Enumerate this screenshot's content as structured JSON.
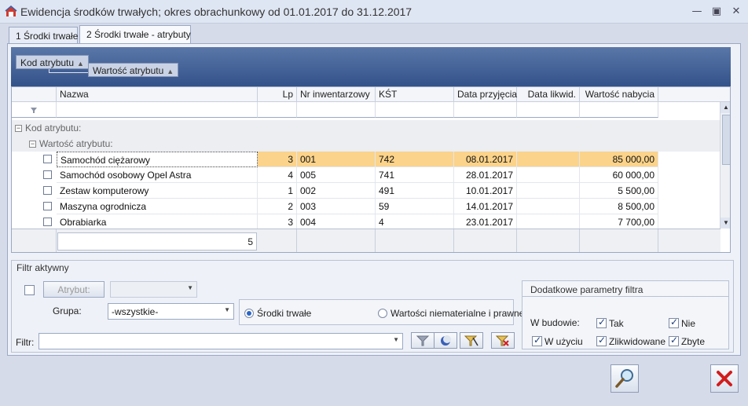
{
  "window": {
    "title": "Ewidencja środków trwałych; okres obrachunkowy od 01.01.2017 do 31.12.2017",
    "minimize": "—",
    "restore": "▣",
    "close": "✕"
  },
  "tabs": [
    {
      "label": "1 Środki trwałe"
    },
    {
      "label": "2 Środki trwałe - atrybuty"
    }
  ],
  "grouping": {
    "chip1": "Kod atrybutu",
    "chip2": "Wartość atrybutu"
  },
  "columns": {
    "name": "Nazwa",
    "lp": "Lp",
    "inv": "Nr inwentarzowy",
    "kst": "KŚT",
    "date_acq": "Data przyjęcia",
    "date_liq": "Data likwid.",
    "value": "Wartość nabycia"
  },
  "groups": {
    "g1": "Kod atrybutu:",
    "g2": "Wartość atrybutu:"
  },
  "rows": [
    {
      "name": "Samochód ciężarowy",
      "lp": "3",
      "inv": "001",
      "kst": "742",
      "date_acq": "08.01.2017",
      "date_liq": "",
      "value": "85 000,00"
    },
    {
      "name": "Samochód osobowy Opel Astra",
      "lp": "4",
      "inv": "005",
      "kst": "741",
      "date_acq": "28.01.2017",
      "date_liq": "",
      "value": "60 000,00"
    },
    {
      "name": "Zestaw komputerowy",
      "lp": "1",
      "inv": "002",
      "kst": "491",
      "date_acq": "10.01.2017",
      "date_liq": "",
      "value": "5 500,00"
    },
    {
      "name": "Maszyna ogrodnicza",
      "lp": "2",
      "inv": "003",
      "kst": "59",
      "date_acq": "14.01.2017",
      "date_liq": "",
      "value": "8 500,00"
    },
    {
      "name": "Obrabiarka",
      "lp": "3",
      "inv": "004",
      "kst": "4",
      "date_acq": "23.01.2017",
      "date_liq": "",
      "value": "7 700,00"
    }
  ],
  "footer": {
    "count": "5"
  },
  "filter": {
    "header": "Filtr aktywny",
    "attr_button": "Atrybut:",
    "group_label": "Grupa:",
    "group_value": "-wszystkie-",
    "radio1": "Środki trwałe",
    "radio2": "Wartości niematerialne i prawne",
    "filter_label": "Filtr:",
    "filter_value": "",
    "extra_header": "Dodatkowe parametry filtra",
    "in_construction": "W budowie:",
    "tak": "Tak",
    "nie": "Nie",
    "w_uzyciu": "W użyciu",
    "zlikwidowane": "Zlikwidowane",
    "zbyte": "Zbyte"
  }
}
